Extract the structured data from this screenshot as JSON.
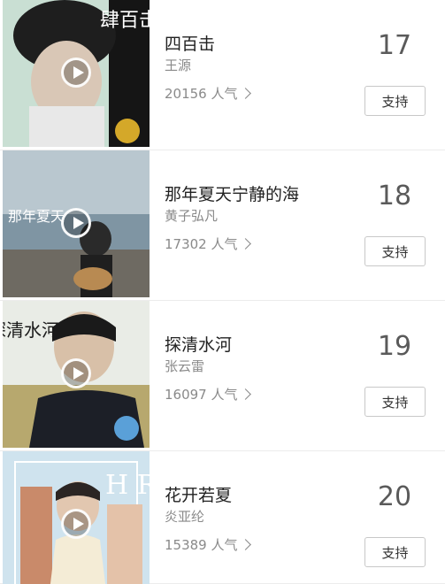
{
  "songs": [
    {
      "title": "四百击",
      "artist": "王源",
      "popularity": "20156 人气",
      "rank": "17",
      "support_label": "支持",
      "cover_text": "肆百击"
    },
    {
      "title": "那年夏天宁静的海",
      "artist": "黄子弘凡",
      "popularity": "17302 人气",
      "rank": "18",
      "support_label": "支持",
      "cover_text": "那年夏天"
    },
    {
      "title": "探清水河",
      "artist": "张云雷",
      "popularity": "16097 人气",
      "rank": "19",
      "support_label": "支持",
      "cover_text": "探清水河"
    },
    {
      "title": "花开若夏",
      "artist": "炎亚纶",
      "popularity": "15389 人气",
      "rank": "20",
      "support_label": "支持",
      "cover_text": "H R"
    }
  ]
}
